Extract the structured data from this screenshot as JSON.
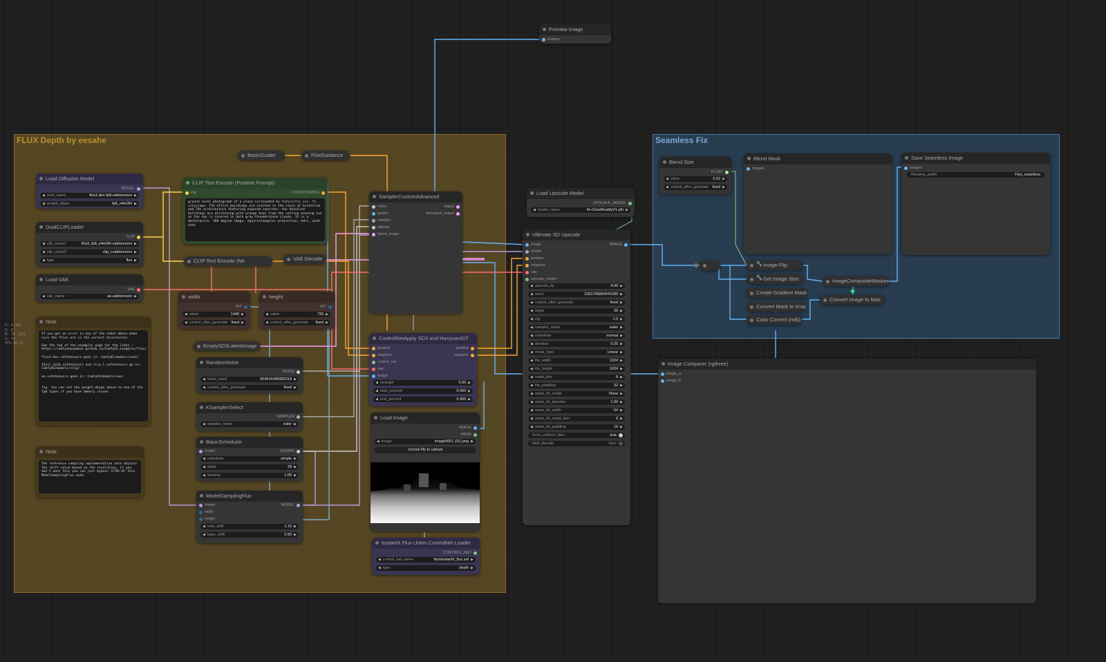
{
  "groups": {
    "flux": "FLUX Depth by eesahe",
    "seamless": "Seamless Fix"
  },
  "overlay": [
    "T: 0.00s",
    "I: 0",
    "N: 36 [36]",
    "V: 74",
    "FPS:58.82"
  ],
  "colors": {
    "model": "#b39ddb",
    "clip": "#ffd54f",
    "vae": "#ff6e6e",
    "conditioning": "#ffa931",
    "latent": "#ff9cf9",
    "image": "#64b5f6",
    "mask": "#81c784",
    "int": "#29699c",
    "float": "#aaee88"
  },
  "nodes": {
    "preview_image": {
      "title": "Preview Image",
      "inputs": [
        "images"
      ]
    },
    "basic_guider": {
      "title": "BasicGuider"
    },
    "flux_guidance": {
      "title": "FluxGuidance"
    },
    "load_diffusion": {
      "title": "Load Diffusion Model",
      "output": "MODEL",
      "w1_label": "unet_name",
      "w1_value": "flux1-dev-fp8.safetensors",
      "w2_label": "weight_dtype",
      "w2_value": "fp8_e4m3fn"
    },
    "dual_clip": {
      "title": "DualCLIPLoader",
      "output": "CLIP",
      "w1_label": "clip_name1",
      "w1_value": "t5xxl_fp8_e4m3fn.safetensors",
      "w2_label": "clip_name2",
      "w2_value": "clip_l.safetensors",
      "w3_label": "type",
      "w3_value": "flux"
    },
    "load_vae": {
      "title": "Load VAE",
      "output": "VAE",
      "w1_label": "vae_name",
      "w1_value": "ae.safetensors"
    },
    "clip_pos": {
      "title": "CLIP Text Encode (Positive Prompt)",
      "input": "clip",
      "output": "CONDITIONING",
      "text": "ground level photograph of a plaza surrounded by futuristic sci- fi cityscape. The office buildings are erected in the style of brutalism and 70s architecture featuring exposed concrete. the detailed buildings are glistening with orange hues from the setting evening sun as the sky is covered in dark gray thunderstorm clouds. It is a masterpiece. 360 degree image, equirectangular projection, hdri, wide shot"
    },
    "clip_neg": {
      "title": "CLIP Text Encode (Ne"
    },
    "vae_decode": {
      "title": "VAE Decode"
    },
    "sampler": {
      "title": "SamplerCustomAdvanced",
      "inputs": [
        "noise",
        "guider",
        "sampler",
        "sigmas",
        "latent_image"
      ],
      "outputs": [
        "output",
        "denoised_output"
      ]
    },
    "width": {
      "title": "width",
      "output": "INT",
      "w1_label": "value",
      "w1_value": "1440",
      "w2_label": "control_after_generate",
      "w2_value": "fixed"
    },
    "height": {
      "title": "height",
      "output": "INT",
      "w1_label": "value",
      "w1_value": "720",
      "w2_label": "control_after_generate",
      "w2_value": "fixed"
    },
    "note1": {
      "title": "Note",
      "text": "If you get an error in any of the nodes above make sure the files are in the correct directories.\n\nSee the top of the examples page for the links : https://comfyanonymous.github.io/ComfyUI_examples/flux/\n\nflux1-dev.safetensors goes in: ComfyUI/models/unet/\n\nt5xxl_fp16.safetensors and clip_l.safetensors go in: ComfyUI/models/clip/\n\nae.safetensors goes in: ComfyUI/models/vae/\n\n\nTip: You can set the weight_dtype above to one of the fp8 types if you have memory issues."
    },
    "note2": {
      "title": "Note",
      "text": "The reference sampling implementation auto adjusts the shift value based on the resolution, if you don't want this you can just bypass (CTRL-B) this ModelSamplingFlux node."
    },
    "empty_latent": {
      "title": "EmptySD3LatentImage"
    },
    "random_noise": {
      "title": "RandomNoise",
      "output": "NOISE",
      "w1_label": "noise_seed",
      "w1_value": "554516488382218",
      "w2_label": "control_after_generate",
      "w2_value": "fixed"
    },
    "ksampler_select": {
      "title": "KSamplerSelect",
      "output": "SAMPLER",
      "w1_label": "sampler_name",
      "w1_value": "euler"
    },
    "basic_scheduler": {
      "title": "BasicScheduler",
      "input": "model",
      "output": "SIGMAS",
      "w1_label": "scheduler",
      "w1_value": "simple",
      "w2_label": "steps",
      "w2_value": "28",
      "w3_label": "denoise",
      "w3_value": "1.00"
    },
    "model_sampling": {
      "title": "ModelSamplingFlux",
      "inputs": [
        "model",
        "width",
        "height"
      ],
      "output": "MODEL",
      "w1_label": "max_shift",
      "w1_value": "1.15",
      "w2_label": "base_shift",
      "w2_value": "0.50"
    },
    "controlnet_apply": {
      "title": "ControlNetApply SD3 and HunyuanDiT",
      "inputs": [
        "positive",
        "negative",
        "control_net",
        "vae",
        "image"
      ],
      "outputs": [
        "positive",
        "negative"
      ],
      "w1_label": "strength",
      "w1_value": "0.65",
      "w2_label": "start_percent",
      "w2_value": "0.000",
      "w3_label": "end_percent",
      "w3_value": "0.400"
    },
    "load_image": {
      "title": "Load Image",
      "outputs": [
        "IMAGE",
        "MASK"
      ],
      "w1_label": "image",
      "w1_value": "image0001 (31).png",
      "upload": "choose file to upload"
    },
    "instantx": {
      "title": "InstantX Flux Union ControlNet Loader",
      "output": "CONTROL_NET",
      "w1_label": "control_net_name",
      "w1_value": "flux\\instantX_flux.saf",
      "w2_label": "type",
      "w2_value": "depth"
    },
    "load_upscale": {
      "title": "Load Upscale Model",
      "output": "UPSCALE_MODEL",
      "w1_label": "model_name",
      "w1_value": "4x-ClearRealityV1.pth"
    },
    "ultimate": {
      "title": "Ultimate SD Upscale",
      "inputs": [
        "image",
        "model",
        "positive",
        "negative",
        "vae",
        "upscale_model"
      ],
      "output": "IMAGE",
      "widgets": [
        {
          "label": "upscale_by",
          "value": "4.00"
        },
        {
          "label": "seed",
          "value": "1091706860441090"
        },
        {
          "label": "control_after_generate",
          "value": "fixed"
        },
        {
          "label": "steps",
          "value": "35"
        },
        {
          "label": "cfg",
          "value": "1.0"
        },
        {
          "label": "sampler_name",
          "value": "euler"
        },
        {
          "label": "scheduler",
          "value": "normal"
        },
        {
          "label": "denoise",
          "value": "0.25"
        },
        {
          "label": "mode_type",
          "value": "Linear"
        },
        {
          "label": "tile_width",
          "value": "1024"
        },
        {
          "label": "tile_height",
          "value": "1024"
        },
        {
          "label": "mask_blur",
          "value": "8"
        },
        {
          "label": "tile_padding",
          "value": "32"
        },
        {
          "label": "seam_fix_mode",
          "value": "None"
        },
        {
          "label": "seam_fix_denoise",
          "value": "1.00"
        },
        {
          "label": "seam_fix_width",
          "value": "64"
        },
        {
          "label": "seam_fix_mask_blur",
          "value": "8"
        },
        {
          "label": "seam_fix_padding",
          "value": "16"
        },
        {
          "label": "force_uniform_tiles",
          "value": "true"
        },
        {
          "label": "tiled_decode",
          "value": "false"
        }
      ]
    },
    "image_comparer": {
      "title": "Image Comparer (rgthree)",
      "inputs": [
        "image_a",
        "image_b"
      ]
    },
    "blend_size": {
      "title": "Blend Size",
      "output": "FLOAT",
      "w1_label": "value",
      "w1_value": "0.02",
      "w2_label": "control_after_generate",
      "w2_value": "fixed"
    },
    "blend_mask": {
      "title": "Blend Mask",
      "input": "images"
    },
    "save_seamless": {
      "title": "Save Seamless Image",
      "input": "images",
      "w1_label": "filename_prefix",
      "w1_value": "Flux_seamless"
    },
    "image_flip": {
      "title": "Image Flip"
    },
    "get_image_size": {
      "title": "Get Image Size"
    },
    "create_gradient": {
      "title": "Create Gradient Mask"
    },
    "convert_mask_to_image": {
      "title": "Convert Mask to Imag"
    },
    "color_correct": {
      "title": "Color Correct (mtb)"
    },
    "image_composite": {
      "title": "ImageCompositeMasked"
    },
    "convert_image_to_mask": {
      "title": "Convert Image to Mas"
    }
  }
}
